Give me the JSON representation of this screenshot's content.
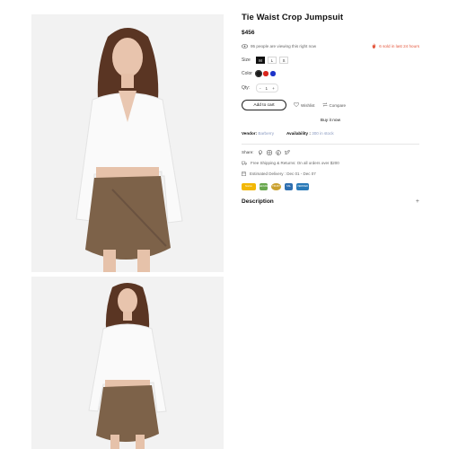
{
  "product": {
    "title": "Tie Waist Crop Jumpsuit",
    "price": "$456",
    "viewing_text": "95 people are viewing this right now",
    "sold_text": "6 sold in last 24 hours"
  },
  "options": {
    "size_label": "Size",
    "sizes": [
      "M",
      "L",
      "S"
    ],
    "selected_size": "M",
    "color_label": "Color",
    "colors": [
      "#1a1a1a",
      "#d9251c",
      "#1d34c9"
    ],
    "qty_label": "Qty:",
    "qty_minus": "-",
    "qty_value": "1",
    "qty_plus": "+"
  },
  "actions": {
    "add_to_cart": "Add to cart",
    "wishlist": "Wishlist",
    "compare": "Compare",
    "buy_now": "Buy it now"
  },
  "meta": {
    "vendor_label": "Vendor:",
    "vendor_value": "Barberry",
    "availability_label": "Availability :",
    "availability_value": "300 in stock",
    "share_label": "Share:",
    "shipping_text": "Free Shipping & Returns: On all orders over $200",
    "delivery_text": "Estimated Delivery : Dec 01 - Dec 07"
  },
  "badges": [
    {
      "name": "norton-badge",
      "label": "Norton",
      "color": "#f2b705"
    },
    {
      "name": "mcafee-badge",
      "label": "SECURE",
      "color": "#6aa84f"
    },
    {
      "name": "trust-badge",
      "label": "TRUST",
      "color": "#caa12f"
    },
    {
      "name": "ssl-badge",
      "label": "SSL",
      "color": "#2f6fb0"
    },
    {
      "name": "verified-badge",
      "label": "VERIFIED",
      "color": "#2a7ab8"
    }
  ],
  "description_label": "Description",
  "description_toggle": "+",
  "icons": [
    "eye-icon",
    "fire-icon",
    "heart-icon",
    "compare-icon",
    "pinterest-icon",
    "instagram-icon",
    "facebook-icon",
    "twitter-icon",
    "truck-icon",
    "calendar-icon",
    "plus-icon"
  ]
}
